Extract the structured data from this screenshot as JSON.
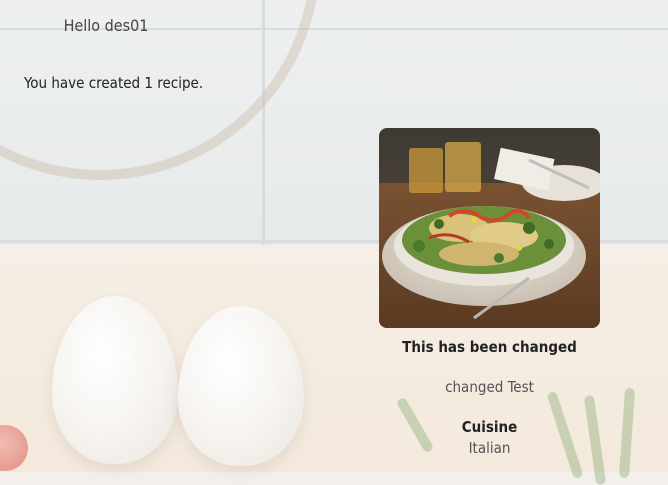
{
  "header": {
    "greeting": "Hello des01",
    "recipe_count_text": "You have created 1 recipe."
  },
  "recipe_card": {
    "title": "This has been changed",
    "description": "changed Test",
    "cuisine_label": "Cuisine",
    "cuisine_value": "Italian",
    "image_icon": "salad-photo"
  }
}
